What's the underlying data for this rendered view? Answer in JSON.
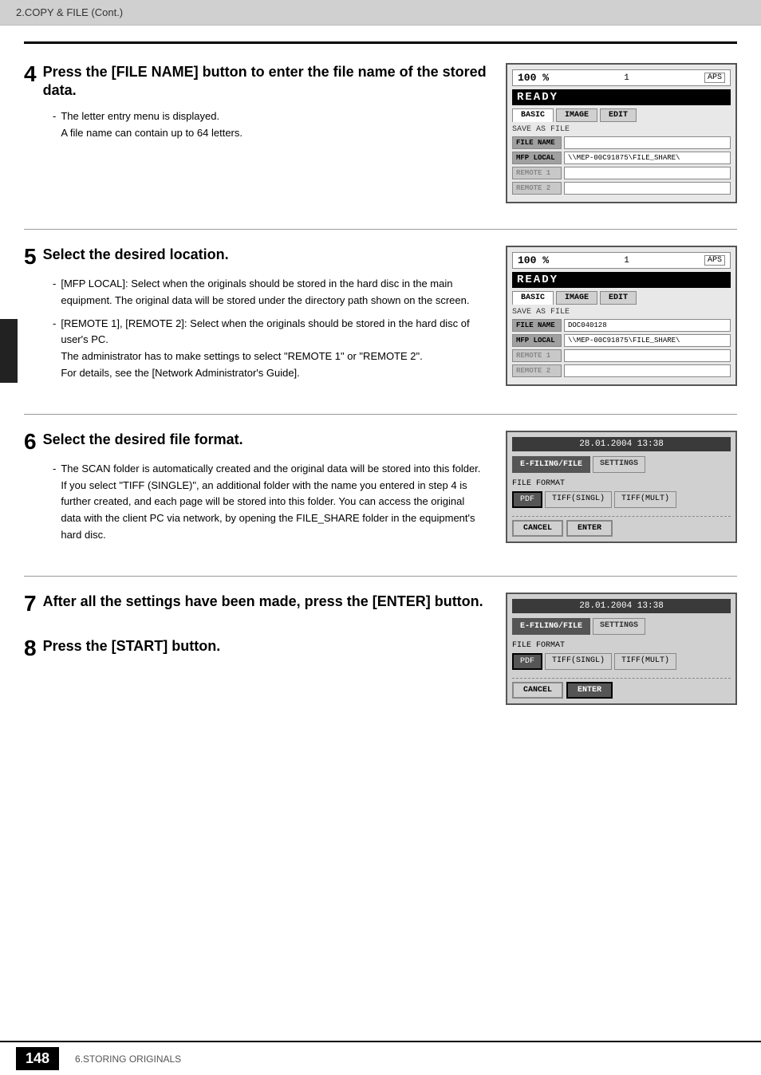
{
  "header": {
    "title": "2.COPY & FILE (Cont.)"
  },
  "footer": {
    "page_number": "148",
    "section": "6.STORING ORIGINALS"
  },
  "steps": [
    {
      "number": "4",
      "title": "Press the [FILE NAME] button to enter the file name of the stored data.",
      "body": [
        "- The letter entry menu is displayed.",
        "  A file name can contain up to 64 letters."
      ],
      "screen": {
        "type": "save_as_file",
        "top": "100 %  1  APS",
        "ready": "READY",
        "tabs": [
          "BASIC",
          "IMAGE",
          "EDIT"
        ],
        "save_label": "SAVE AS FILE",
        "rows": [
          {
            "label": "FILE NAME",
            "value": "",
            "active": true
          },
          {
            "label": "MFP LOCAL",
            "value": "\\\\MEP-00C91875\\FILE_SHARE\\",
            "active": true
          },
          {
            "label": "REMOTE 1",
            "value": "",
            "active": false
          },
          {
            "label": "REMOTE 2",
            "value": "",
            "active": false
          }
        ]
      }
    },
    {
      "number": "5",
      "title": "Select the desired location.",
      "body": [
        "- [MFP LOCAL]: Select when the originals should be stored in the hard disc in the main equipment. The original data will be stored under the directory path shown on the screen.",
        "- [REMOTE 1], [REMOTE 2]: Select when the originals should be stored in the hard disc of user's PC.",
        "  The administrator has to make settings to select \"REMOTE 1\" or \"REMOTE 2\".",
        "  For details, see the [Network Administrator's Guide]."
      ],
      "screen": {
        "type": "save_as_file",
        "top": "100 %  1  APS",
        "ready": "READY",
        "tabs": [
          "BASIC",
          "IMAGE",
          "EDIT"
        ],
        "save_label": "SAVE AS FILE",
        "rows": [
          {
            "label": "FILE NAME",
            "value": "DOC040128",
            "active": true
          },
          {
            "label": "MFP LOCAL",
            "value": "\\\\MEP-00C91875\\FILE_SHARE\\",
            "active": true
          },
          {
            "label": "REMOTE 1",
            "value": "",
            "active": false
          },
          {
            "label": "REMOTE 2",
            "value": "",
            "active": false
          }
        ]
      }
    },
    {
      "number": "6",
      "title": "Select the desired file format.",
      "body": [
        "- The SCAN folder is automatically created and the original data will be stored into this folder. If you select \"TIFF (SINGLE)\", an additional folder with the name you entered in step 4 is further created, and each page will be stored into this folder. You can access the original data with the client PC via network, by opening the FILE_SHARE folder in the equipment's hard disc."
      ],
      "screen": {
        "type": "file_format",
        "datetime": "28.01.2004  13:38",
        "tabs": [
          "E-FILING/FILE",
          "SETTINGS"
        ],
        "active_tab": 0,
        "format_label": "FILE FORMAT",
        "formats": [
          "PDF",
          "TIFF(SINGL)",
          "TIFF(MULT)"
        ],
        "active_format": 0,
        "cancel_label": "CANCEL",
        "enter_label": "ENTER",
        "enter_highlighted": false
      }
    },
    {
      "number": "7",
      "title": "After all the settings have been made, press the [ENTER] button.",
      "body": [],
      "screen": null
    },
    {
      "number": "8",
      "title": "Press the [START] button.",
      "body": [],
      "screen": {
        "type": "file_format",
        "datetime": "28.01.2004  13:38",
        "tabs": [
          "E-FILING/FILE",
          "SETTINGS"
        ],
        "active_tab": 0,
        "format_label": "FILE FORMAT",
        "formats": [
          "PDF",
          "TIFF(SINGL)",
          "TIFF(MULT)"
        ],
        "active_format": 0,
        "cancel_label": "CANCEL",
        "enter_label": "ENTER",
        "enter_highlighted": true
      }
    }
  ]
}
